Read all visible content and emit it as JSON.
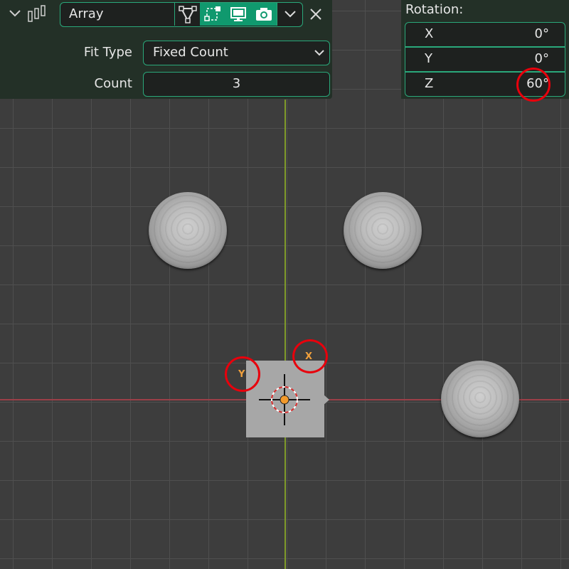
{
  "modifier": {
    "name": "Array",
    "icons": [
      "collapse-chevron-icon",
      "array-modifier-icon",
      "edit-mode-icon",
      "on-cage-icon",
      "realtime-display-icon",
      "render-camera-icon",
      "dropdown-chevron-icon",
      "close-icon"
    ]
  },
  "fit_type": {
    "label": "Fit Type",
    "value": "Fixed Count"
  },
  "count": {
    "label": "Count",
    "value": "3"
  },
  "rotation": {
    "title": "Rotation:",
    "x": {
      "axis": "X",
      "value": "0°"
    },
    "y": {
      "axis": "Y",
      "value": "0°"
    },
    "z": {
      "axis": "Z",
      "value": "60°"
    }
  },
  "viewport": {
    "empty_axes": {
      "x": "X",
      "y": "Y"
    },
    "colors": {
      "x_axis": "#9c3f48",
      "y_axis": "#7f9a2a",
      "accent": "#2aa87a",
      "highlight": "#e8000c",
      "axis_label": "#f0a03c"
    }
  }
}
